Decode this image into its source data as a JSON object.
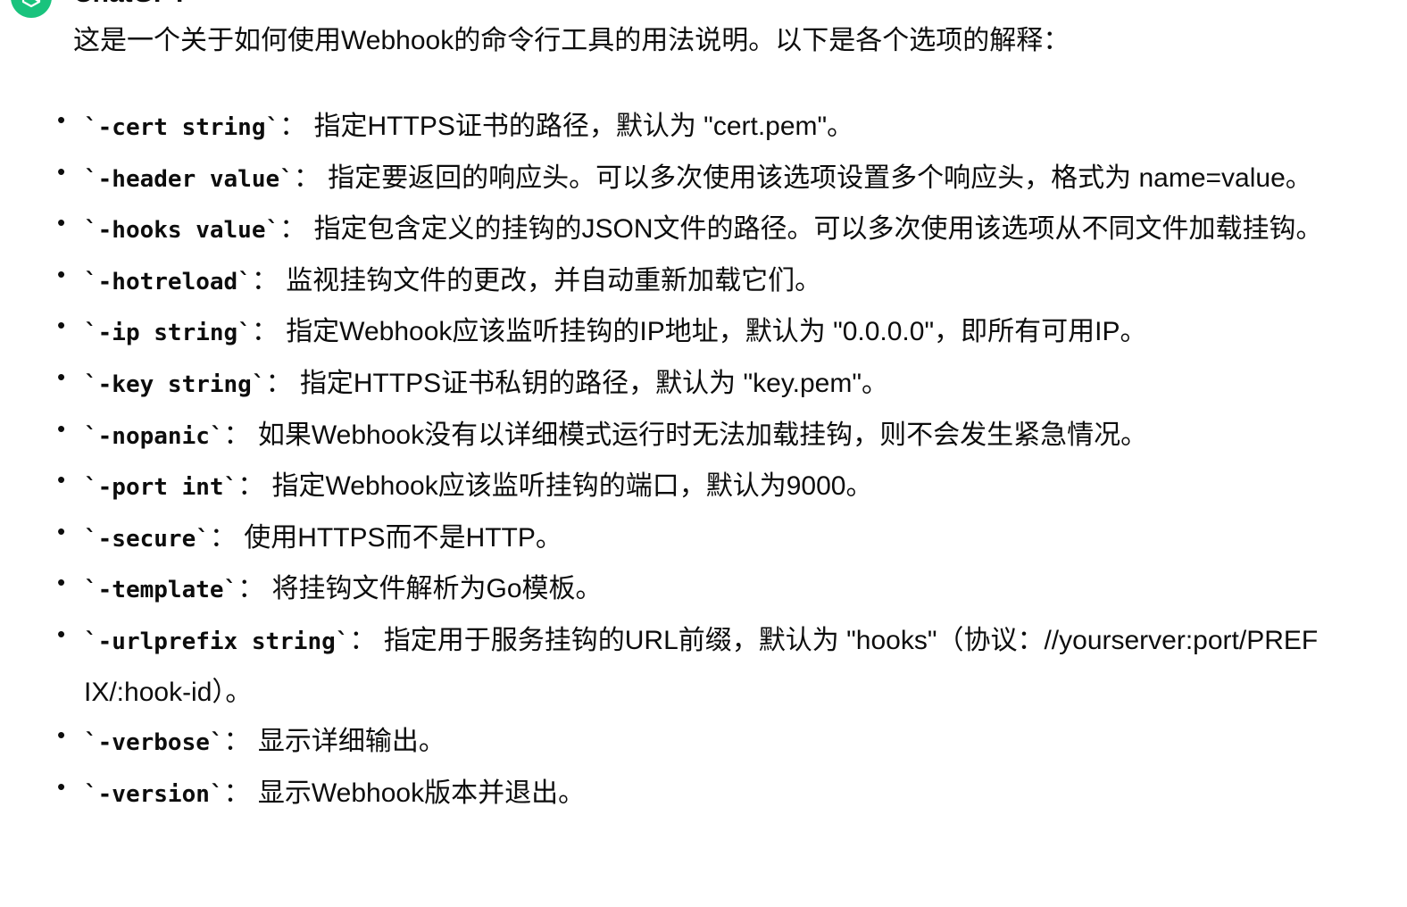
{
  "message": {
    "author": "ChatGPT",
    "avatar_icon": "openai-logo-icon",
    "avatar_color": "#19c37d",
    "intro": "这是一个关于如何使用Webhook的命令行工具的用法说明。以下是各个选项的解释：",
    "options": [
      {
        "flag": "`-cert string`",
        "desc": "指定HTTPS证书的路径，默认为 \"cert.pem\"。"
      },
      {
        "flag": "`-header value`",
        "desc": "指定要返回的响应头。可以多次使用该选项设置多个响应头，格式为 name=value。"
      },
      {
        "flag": "`-hooks value`",
        "desc": "指定包含定义的挂钩的JSON文件的路径。可以多次使用该选项从不同文件加载挂钩。"
      },
      {
        "flag": "`-hotreload`",
        "desc": "监视挂钩文件的更改，并自动重新加载它们。"
      },
      {
        "flag": "`-ip string`",
        "desc": "指定Webhook应该监听挂钩的IP地址，默认为 \"0.0.0.0\"，即所有可用IP。"
      },
      {
        "flag": "`-key string`",
        "desc": "指定HTTPS证书私钥的路径，默认为 \"key.pem\"。"
      },
      {
        "flag": "`-nopanic`",
        "desc": "如果Webhook没有以详细模式运行时无法加载挂钩，则不会发生紧急情况。"
      },
      {
        "flag": "`-port int`",
        "desc": "指定Webhook应该监听挂钩的端口，默认为9000。"
      },
      {
        "flag": "`-secure`",
        "desc": "使用HTTPS而不是HTTP。"
      },
      {
        "flag": "`-template`",
        "desc": "将挂钩文件解析为Go模板。"
      },
      {
        "flag": "`-urlprefix string`",
        "desc": "指定用于服务挂钩的URL前缀，默认为 \"hooks\"（协议：//yourserver:port/PREFIX/:hook-id）。"
      },
      {
        "flag": "`-verbose`",
        "desc": "显示详细输出。"
      },
      {
        "flag": "`-version`",
        "desc": "显示Webhook版本并退出。"
      }
    ]
  }
}
